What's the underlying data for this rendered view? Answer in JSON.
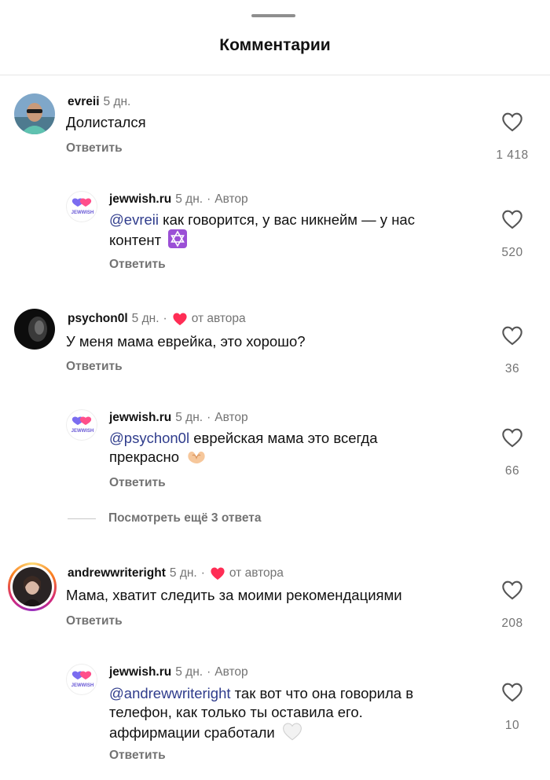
{
  "header": {
    "title": "Комментарии"
  },
  "comments": [
    {
      "user": "evreii",
      "time": "5 дн.",
      "text": "Долистался",
      "reply_label": "Ответить",
      "likes": "1 418"
    },
    {
      "user": "jewwish.ru",
      "time": "5 дн.",
      "dot": "·",
      "author_tag": "Автор",
      "mention": "@evreii",
      "text_line1": " как говорится, у вас никнейм — у нас",
      "text_line2": "контент",
      "emoji": "star-of-david",
      "reply_label": "Ответить",
      "likes": "520"
    },
    {
      "user": "psychon0l",
      "time": "5 дн.",
      "dot": "·",
      "liked_by": "от автора",
      "text": "У меня мама еврейка, это хорошо?",
      "reply_label": "Ответить",
      "likes": "36"
    },
    {
      "user": "jewwish.ru",
      "time": "5 дн.",
      "dot": "·",
      "author_tag": "Автор",
      "mention": "@psychon0l",
      "text_line1": " еврейская мама это всегда",
      "text_line2": "прекрасно",
      "emoji": "heart-hands",
      "reply_label": "Ответить",
      "likes": "66"
    },
    {
      "user": "andrewwriteright",
      "time": "5 дн.",
      "dot": "·",
      "liked_by": "от автора",
      "text": "Мама, хватит следить за моими рекомендациями",
      "reply_label": "Ответить",
      "likes": "208"
    },
    {
      "user": "jewwish.ru",
      "time": "5 дн.",
      "dot": "·",
      "author_tag": "Автор",
      "mention": "@andrewwriteright",
      "text_line1": " так вот что она говорила в",
      "text_line2": "телефон, как только ты оставила его.",
      "text_line3": "аффирмации сработали",
      "emoji": "white-heart",
      "reply_label": "Ответить",
      "likes": "10"
    }
  ],
  "more_replies": "Посмотреть ещё 3 ответа",
  "logo_text": "JEWWISH",
  "colors": {
    "accent_red": "#ff2d55",
    "mention": "#2f3c8c",
    "muted": "#737373"
  }
}
